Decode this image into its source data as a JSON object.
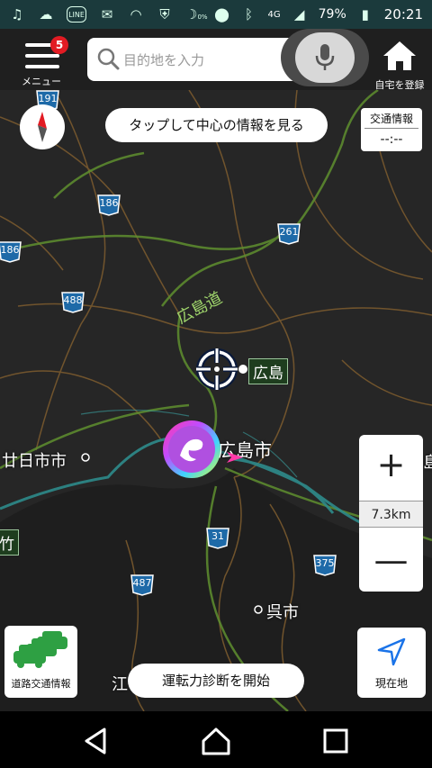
{
  "status_bar": {
    "battery": "79%",
    "time": "20:21",
    "network": "4G",
    "data_saver": "0%",
    "left_icons": [
      "music-icon",
      "weather-icon",
      "line-icon",
      "mail-icon",
      "wifi-icon",
      "shield-icon",
      "moon-icon"
    ],
    "right_icons": [
      "location-icon",
      "bluetooth-icon",
      "signal-icon",
      "battery-icon"
    ]
  },
  "app_bar": {
    "menu_label": "メニュー",
    "menu_badge": "5",
    "search_placeholder": "目的地を入力",
    "home_label": "自宅を登録"
  },
  "map": {
    "info_pill": "タップして中心の情報を見る",
    "traffic_info": {
      "title": "交通情報",
      "time": "--:--"
    },
    "route_shields": [
      "191",
      "186",
      "186",
      "261",
      "488",
      "31",
      "487",
      "375"
    ],
    "labels": {
      "expressway": "広島道",
      "station": "広島",
      "city_hiroshima": "広島市",
      "city_hatsukaichi": "廿日市市",
      "city_kure": "呉市",
      "partial_left": "竹",
      "partial_bottom": "江",
      "partial_right": "島"
    },
    "scale": "7.3km",
    "zoom_in": "+",
    "zoom_out": "—",
    "traffic_button_label": "道路交通情報",
    "drive_pill": "運転力診断を開始",
    "locate_label": "現在地"
  },
  "colors": {
    "status_bar": "#1b3a3c",
    "map_bg": "#262626",
    "road_green": "#6f9e3a",
    "river_teal": "#2e8b8b",
    "badge_red": "#e21b23",
    "locate_blue": "#1a73e8"
  }
}
